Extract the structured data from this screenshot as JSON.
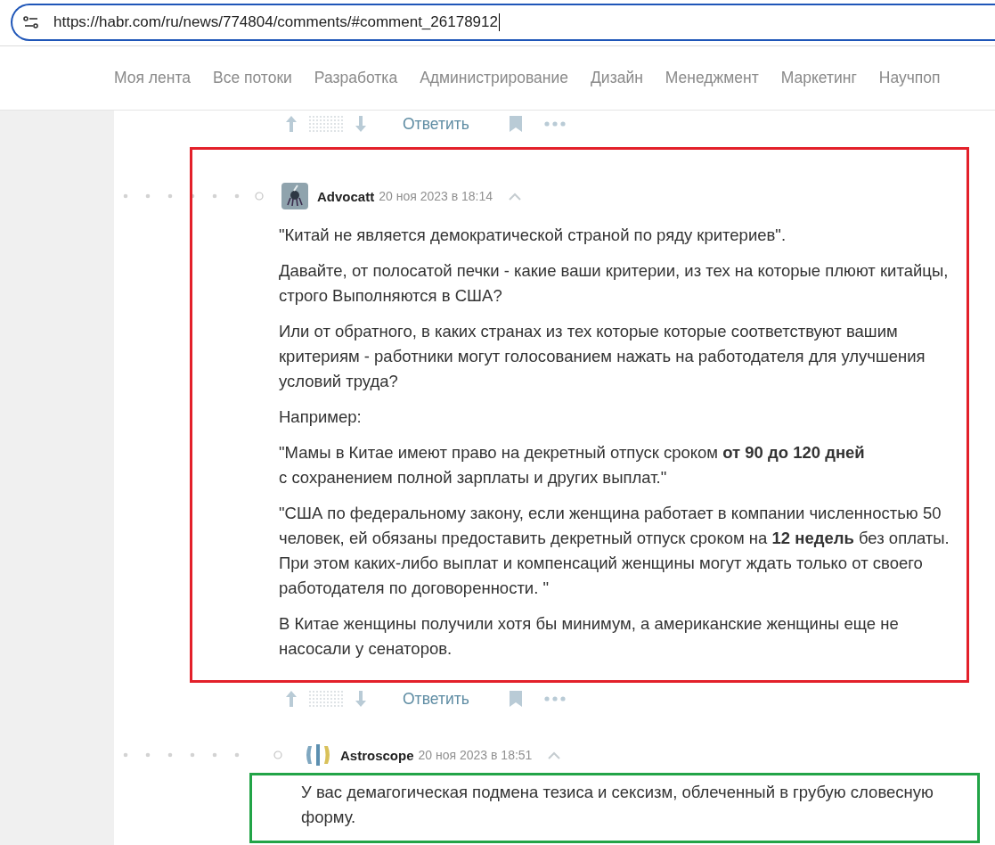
{
  "address_bar": {
    "url": "https://habr.com/ru/news/774804/comments/#comment_26178912"
  },
  "nav": [
    "Моя лента",
    "Все потоки",
    "Разработка",
    "Администрирование",
    "Дизайн",
    "Менеджмент",
    "Маркетинг",
    "Научпоп"
  ],
  "top_actions": {
    "reply": "Ответить"
  },
  "comments": [
    {
      "author": "Advocatt",
      "date": "20 ноя 2023 в 18:14",
      "paragraphs": [
        "\"Китай не является демократической страной по ряду критериев\".",
        "Давайте, от полосатой печки - какие ваши критерии, из тех на которые плюют китайцы, строго Выполняются в США?",
        "Или от обратного, в каких странах из тех которые которые соответствуют вашим критериям - работники могут голосованием нажать на работодателя для улучшения условий труда?",
        "Например:",
        "\"Мамы в Китае имеют право на декретный отпуск сроком **от 90 до 120 дней**\nс сохранением полной зарплаты и других выплат.\"",
        "\"США по федеральному закону, если женщина работает в компании численностью 50 человек, ей обязаны предоставить декретный отпуск сроком на **12 недель** без оплаты. При этом каких-либо выплат и компенсаций женщины могут ждать только от своего работодателя по договоренности. \"",
        "В Китае женщины получили хотя бы минимум, а американские женщины еще не насосали у сенаторов."
      ],
      "reply": "Ответить"
    },
    {
      "author": "Astroscope",
      "date": "20 ноя 2023 в 18:51",
      "paragraphs": [
        "У вас демагогическая подмена тезиса и сексизм, облеченный в грубую словесную форму."
      ]
    }
  ],
  "highlights": [
    {
      "color": "#e3202a"
    },
    {
      "color": "#22a447"
    }
  ]
}
